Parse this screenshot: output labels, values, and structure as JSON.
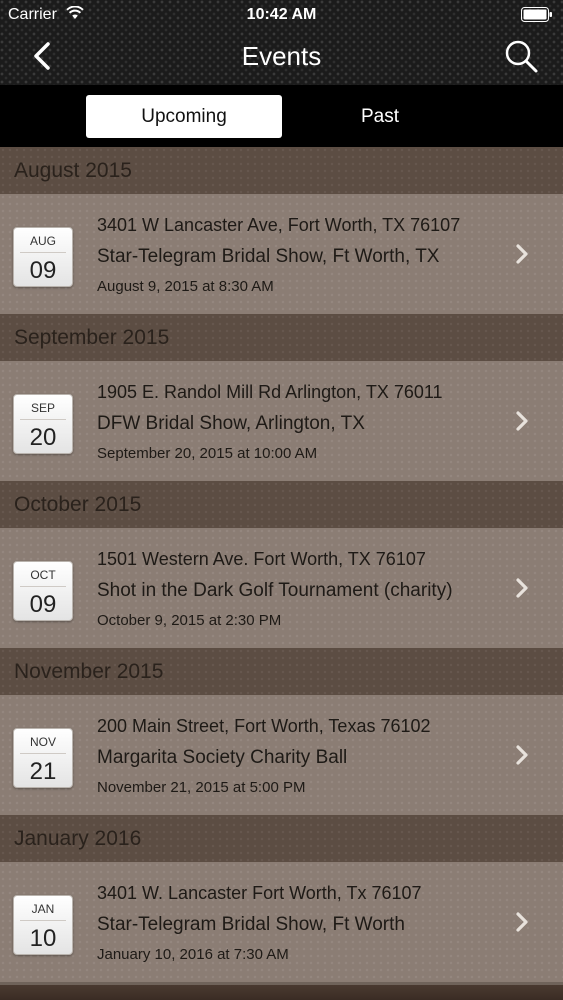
{
  "status_bar": {
    "carrier": "Carrier",
    "time": "10:42 AM"
  },
  "nav": {
    "title": "Events",
    "back_icon": "chevron-left-icon",
    "search_icon": "search-icon"
  },
  "tabs": [
    {
      "label": "Upcoming",
      "selected": true
    },
    {
      "label": "Past",
      "selected": false
    }
  ],
  "sections": [
    {
      "header": "August 2015",
      "event": {
        "month": "AUG",
        "day": "09",
        "address": "3401 W Lancaster Ave, Fort Worth, TX 76107",
        "title": "Star-Telegram Bridal Show, Ft Worth, TX",
        "datetime": "August 9, 2015 at 8:30 AM"
      }
    },
    {
      "header": "September 2015",
      "event": {
        "month": "SEP",
        "day": "20",
        "address": "1905 E. Randol Mill Rd Arlington, TX 76011",
        "title": "DFW Bridal Show, Arlington, TX",
        "datetime": "September 20, 2015 at 10:00 AM"
      }
    },
    {
      "header": "October 2015",
      "event": {
        "month": "OCT",
        "day": "09",
        "address": "1501 Western Ave. Fort Worth, TX 76107",
        "title": "Shot in the Dark Golf Tournament (charity)",
        "datetime": "October 9, 2015 at 2:30 PM"
      }
    },
    {
      "header": "November 2015",
      "event": {
        "month": "NOV",
        "day": "21",
        "address": "200 Main Street, Fort Worth, Texas 76102",
        "title": "Margarita Society Charity Ball",
        "datetime": "November 21, 2015 at 5:00 PM"
      }
    },
    {
      "header": "January 2016",
      "event": {
        "month": "JAN",
        "day": "10",
        "address": "3401 W. Lancaster Fort Worth, Tx 76107",
        "title": "Star-Telegram Bridal Show, Ft Worth",
        "datetime": "January 10, 2016 at 7:30 AM"
      }
    }
  ],
  "colors": {
    "nav_background": "#1b1b1b",
    "section_header": "#5c4d43",
    "row_background": "#8b7d74",
    "tab_active": "#ffffff"
  }
}
